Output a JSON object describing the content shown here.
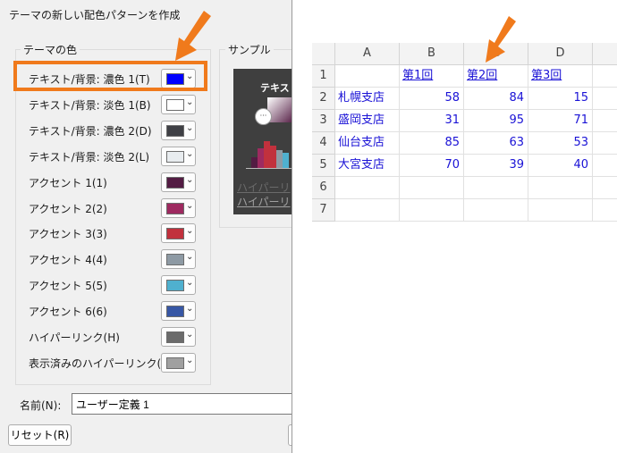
{
  "dialog": {
    "title": "テーマの新しい配色パターンを作成",
    "theme_colors_label": "テーマの色",
    "sample_label": "サンプル",
    "rows": [
      {
        "label": "テキスト/背景: 濃色 1(T)",
        "color": "#0000ff"
      },
      {
        "label": "テキスト/背景: 淡色 1(B)",
        "color": "#ffffff"
      },
      {
        "label": "テキスト/背景: 濃色 2(D)",
        "color": "#3f4045"
      },
      {
        "label": "テキスト/背景: 淡色 2(L)",
        "color": "#e8ecef"
      },
      {
        "label": "アクセント 1(1)",
        "color": "#531c43"
      },
      {
        "label": "アクセント 2(2)",
        "color": "#9e2a60"
      },
      {
        "label": "アクセント 3(3)",
        "color": "#c1313d"
      },
      {
        "label": "アクセント 4(4)",
        "color": "#8e9aa4"
      },
      {
        "label": "アクセント 5(5)",
        "color": "#4fb0cf"
      },
      {
        "label": "アクセント 6(6)",
        "color": "#3757a5"
      },
      {
        "label": "ハイパーリンク(H)",
        "color": "#6b6b6b"
      },
      {
        "label": "表示済みのハイパーリンク(F)",
        "color": "#a0a0a0"
      }
    ],
    "sample": {
      "text": "テキスト",
      "link1": "ハイパーリ",
      "link2": "ハイパーリ"
    },
    "name_label": "名前(N):",
    "name_value": "ユーザー定義 1",
    "reset_label": "リセット(R)",
    "highlight_color": "#f07a1c"
  },
  "sheet": {
    "columns": [
      "A",
      "B",
      "C",
      "D"
    ],
    "rows": [
      "1",
      "2",
      "3",
      "4",
      "5",
      "6",
      "7"
    ],
    "headers": [
      "第1回",
      "第2回",
      "第3回"
    ],
    "data": [
      {
        "name": "札幌支店",
        "values": [
          "58",
          "84",
          "15"
        ]
      },
      {
        "name": "盛岡支店",
        "values": [
          "31",
          "95",
          "71"
        ]
      },
      {
        "name": "仙台支店",
        "values": [
          "85",
          "63",
          "53"
        ]
      },
      {
        "name": "大宮支店",
        "values": [
          "70",
          "39",
          "40"
        ]
      }
    ],
    "text_color": "#1a12d6"
  }
}
